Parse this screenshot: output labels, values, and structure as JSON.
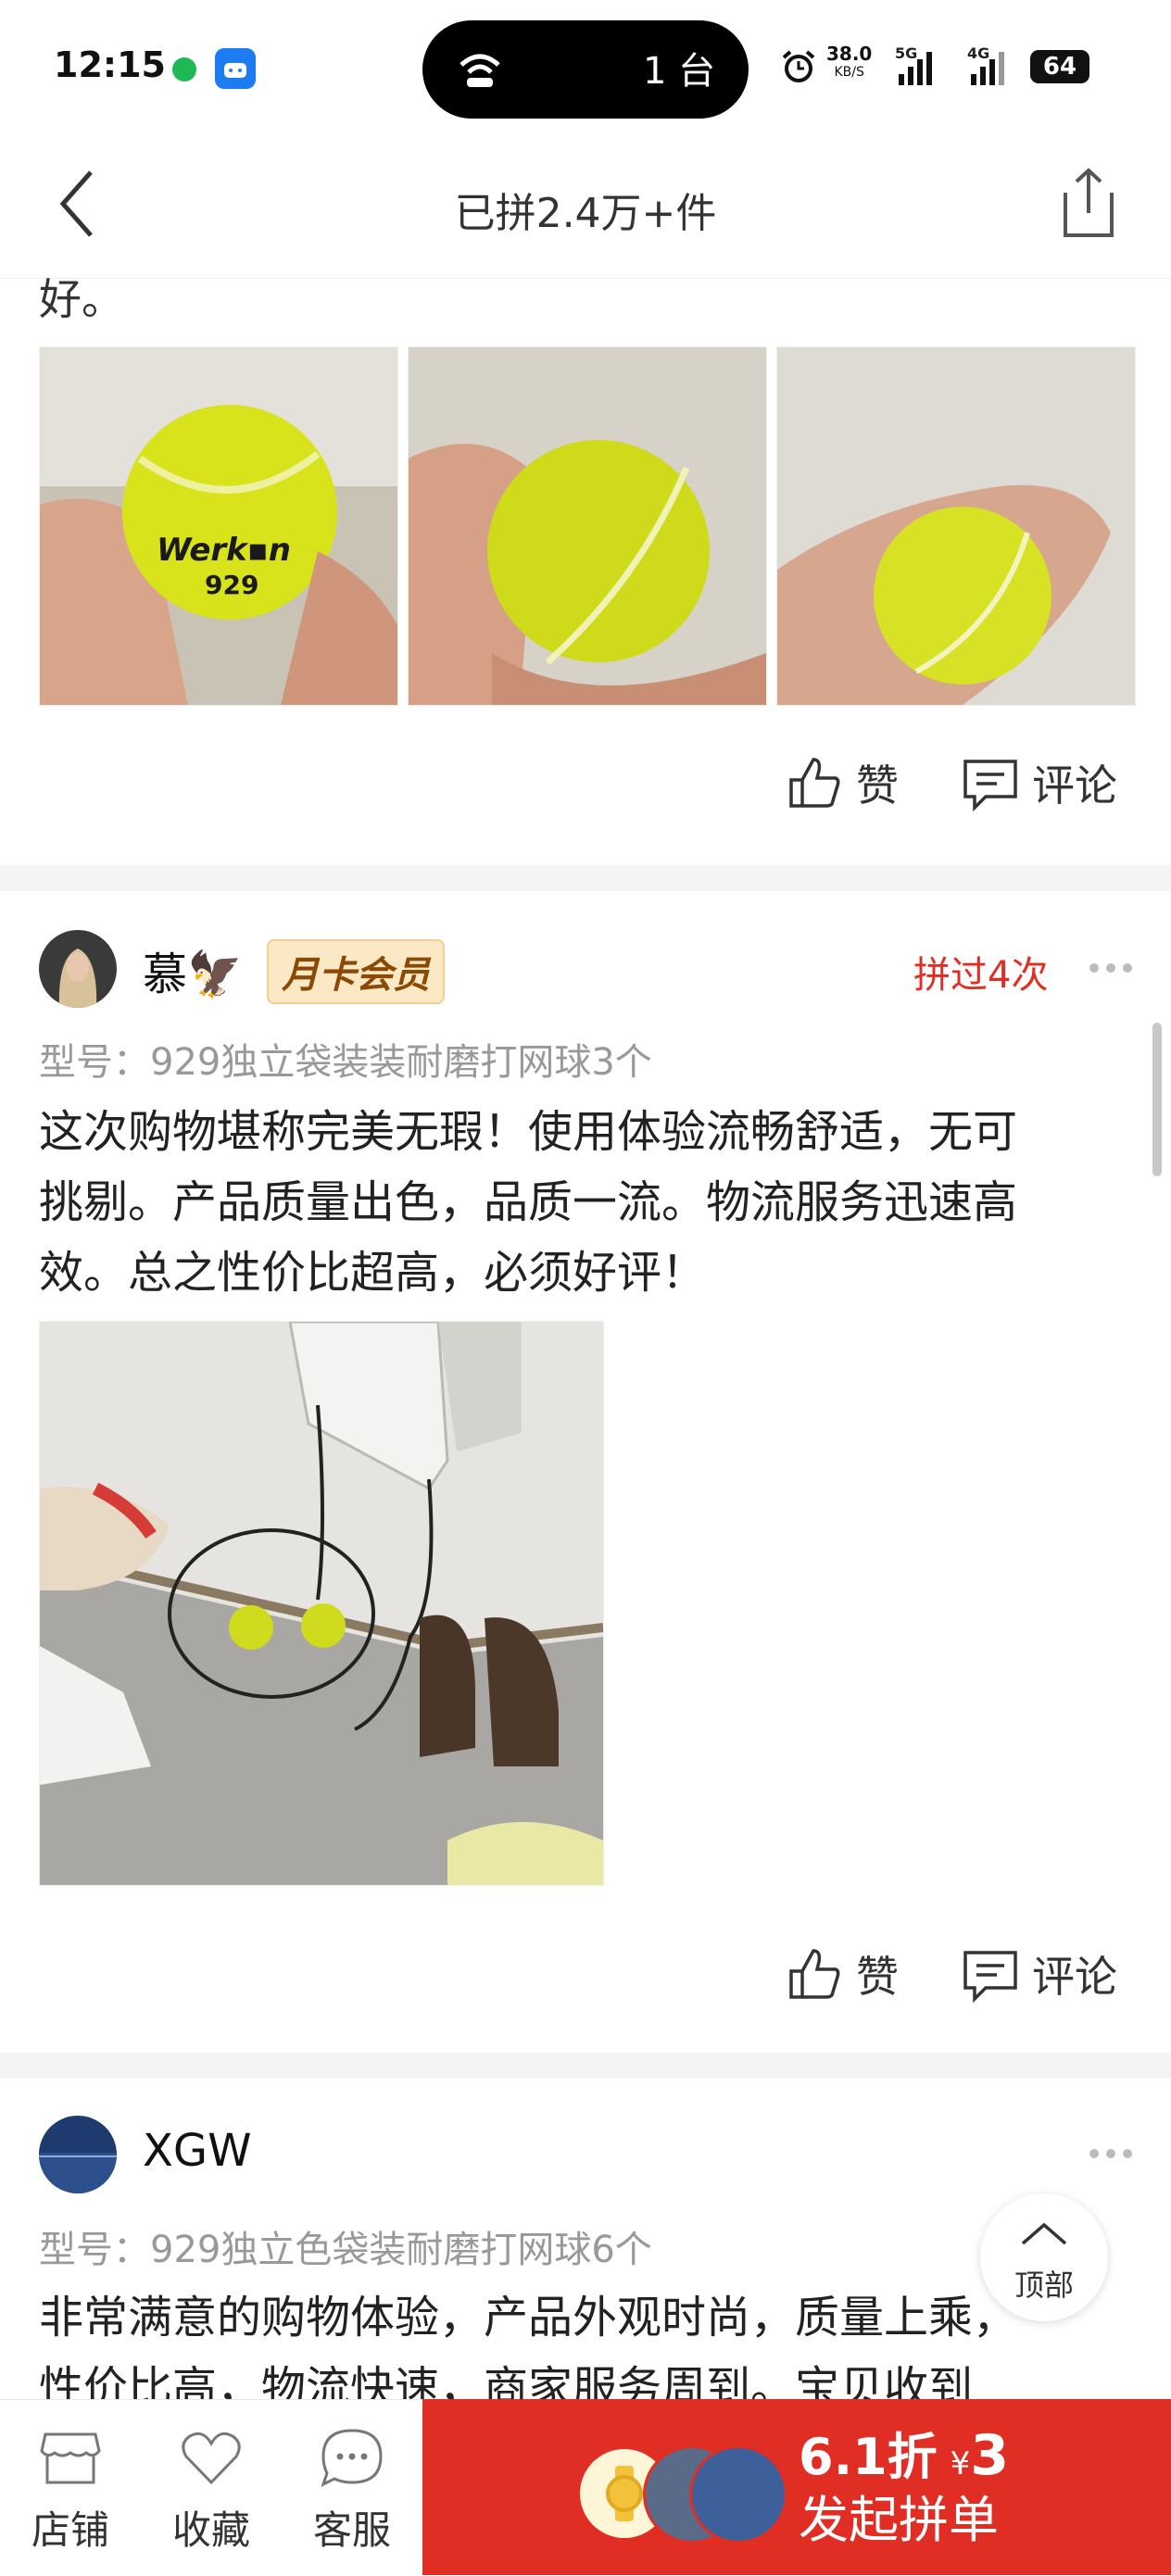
{
  "status_bar": {
    "time": "12:15",
    "island_text": "1 台",
    "net_speed": "38.0",
    "net_speed_unit": "KB/S",
    "signal1_label": "5G",
    "signal2_label": "4G",
    "battery": "64"
  },
  "nav": {
    "title": "已拼2.4万+件"
  },
  "prev_review": {
    "trailing_text": "好。",
    "like_label": "赞",
    "comment_label": "评论"
  },
  "review1": {
    "username": "慕🦅",
    "badge": "月卡会员",
    "repeat_tag": "拼过4次",
    "model": "型号：929独立袋装装耐磨打网球3个",
    "text_lines": [
      "这次购物堪称完美无瑕！使用体验流畅舒适，无可",
      "挑剔。产品质量出色，品质一流。物流服务迅速高",
      "效。总之性价比超高，必须好评！"
    ],
    "like_label": "赞",
    "comment_label": "评论"
  },
  "review2": {
    "username": "XGW",
    "model": "型号：929独立色袋装耐磨打网球6个",
    "text_lines": [
      "非常满意的购物体验，产品外观时尚，质量上乘，",
      "性价比高，物流快速，商家服务周到。宝贝收到"
    ]
  },
  "to_top_label": "顶部",
  "bottom_bar": {
    "shop_label": "店铺",
    "favorite_label": "收藏",
    "service_label": "客服",
    "discount": "6.1折",
    "currency": "¥",
    "price": "3",
    "cta_label": "发起拼单"
  },
  "colors": {
    "accent_red": "#e02e24",
    "badge_bg": "#fbe8c4",
    "divider": "#f4f4f4"
  }
}
